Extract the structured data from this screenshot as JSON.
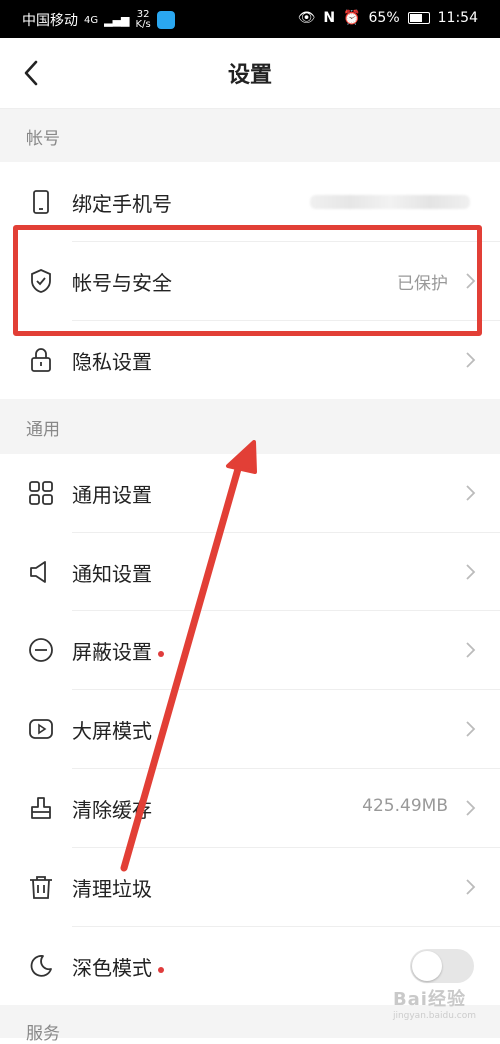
{
  "status_bar": {
    "carrier": "中国移动",
    "network": "4G",
    "speed_value": "32",
    "speed_unit": "K/s",
    "battery": "65%",
    "time": "11:54"
  },
  "header": {
    "title": "设置"
  },
  "sections": {
    "account": "帐号",
    "general": "通用",
    "service": "服务"
  },
  "rows": {
    "bind_phone": {
      "label": "绑定手机号"
    },
    "account_security": {
      "label": "帐号与安全",
      "value": "已保护"
    },
    "privacy": {
      "label": "隐私设置"
    },
    "general_settings": {
      "label": "通用设置"
    },
    "notification": {
      "label": "通知设置"
    },
    "block": {
      "label": "屏蔽设置"
    },
    "big_screen": {
      "label": "大屏模式"
    },
    "clear_cache": {
      "label": "清除缓存",
      "value": "425.49MB"
    },
    "clean_junk": {
      "label": "清理垃圾"
    },
    "dark_mode": {
      "label": "深色模式",
      "enabled": false
    }
  },
  "watermark": {
    "text": "Bai经验",
    "sub": "jingyan.baidu.com"
  },
  "colors": {
    "highlight": "#e23f36",
    "dot": "#e03c3c"
  }
}
